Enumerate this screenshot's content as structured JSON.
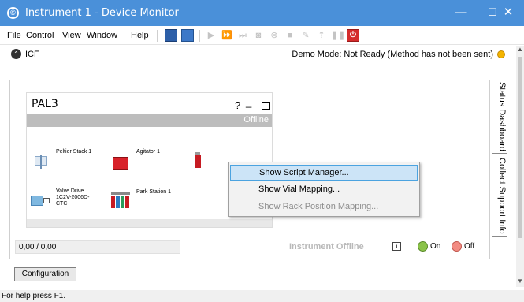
{
  "window": {
    "title": "Instrument 1 - Device Monitor",
    "app_icon": "copyright-style-circle-icon",
    "controls": [
      "—",
      "☐",
      "✕"
    ]
  },
  "menubar": {
    "items": [
      "File",
      "Control",
      "View",
      "Window",
      "Help"
    ],
    "toolbar_icons": [
      "method-blue-icon",
      "method-edit-blue-icon",
      "play-icon",
      "fast-forward-icon",
      "step-icon",
      "camera-icon",
      "stop-circle-icon",
      "stop-square-icon",
      "tool-icon",
      "arrow-up-icon",
      "pause-icon",
      "power-red-icon"
    ]
  },
  "icf": {
    "label": "ICF",
    "demo_status": "Demo Mode: Not Ready (Method has not been sent)",
    "status_color": "#f4b400"
  },
  "side_tabs": {
    "status_dashboard": "Status Dashboard",
    "collect_support": "Collect Support Info"
  },
  "module": {
    "name": "PAL3",
    "help": "?",
    "minimize": "_",
    "state": "Offline",
    "components": {
      "peltier": "Peltier Stack 1",
      "agitator": "Agitator 1",
      "valve_line1": "Valve Drive",
      "valve_line2": "1C2V-2006D-",
      "valve_line3": "CTC",
      "park": "Park Station 1"
    }
  },
  "context_menu": {
    "items": [
      {
        "label": "Show Script Manager...",
        "state": "selected"
      },
      {
        "label": "Show Vial Mapping...",
        "state": "enabled"
      },
      {
        "label": "Show Rack Position Mapping...",
        "state": "disabled"
      }
    ]
  },
  "status_row": {
    "value": "0,00 / 0,00",
    "instrument_state": "Instrument Offline",
    "info": "i",
    "on_label": "On",
    "off_label": "Off",
    "on_color": "#8bc34a",
    "off_color": "#f28b82"
  },
  "configuration_button": "Configuration",
  "statusbar": "For help press F1."
}
